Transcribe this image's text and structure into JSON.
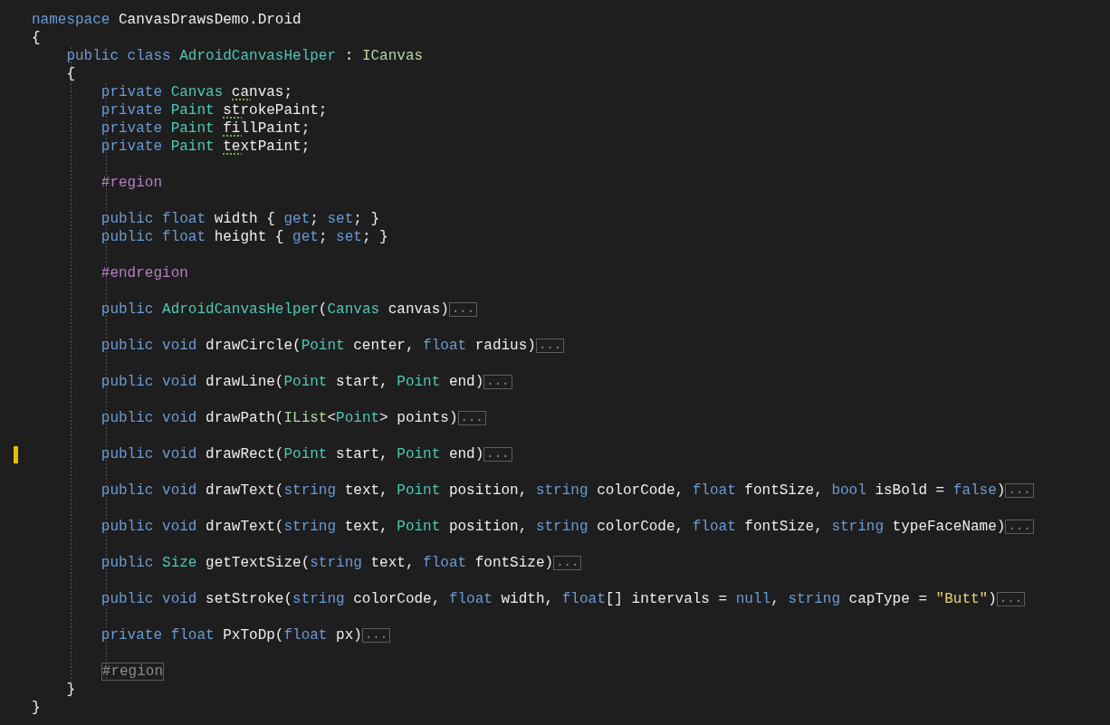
{
  "editor": {
    "lines": [
      {
        "kind": "code",
        "modified": false,
        "tokens": [
          {
            "text": "namespace ",
            "kind": "keyword"
          },
          {
            "text": "CanvasDrawsDemo.Droid",
            "kind": "plain"
          }
        ]
      },
      {
        "kind": "code",
        "modified": false,
        "tokens": [
          {
            "text": "{",
            "kind": "plain"
          }
        ],
        "children": [
          {
            "kind": "code",
            "modified": false,
            "tokens": [
              {
                "text": "public class ",
                "kind": "keyword"
              },
              {
                "text": "AdroidCanvasHelper",
                "kind": "type"
              },
              {
                "text": " : ",
                "kind": "plain"
              },
              {
                "text": "ICanvas",
                "kind": "interface"
              }
            ]
          },
          {
            "kind": "code",
            "modified": false,
            "tokens": [
              {
                "text": "{",
                "kind": "plain"
              }
            ],
            "children": [
              {
                "kind": "code",
                "modified": false,
                "tokens": [
                  {
                    "text": "private ",
                    "kind": "keyword"
                  },
                  {
                    "text": "Canvas ",
                    "kind": "type"
                  },
                  {
                    "text": "canvas",
                    "kind": "warning"
                  },
                  {
                    "text": ";",
                    "kind": "plain"
                  }
                ]
              },
              {
                "kind": "code",
                "modified": false,
                "tokens": [
                  {
                    "text": "private ",
                    "kind": "keyword"
                  },
                  {
                    "text": "Paint ",
                    "kind": "type"
                  },
                  {
                    "text": "strokePaint",
                    "kind": "warning"
                  },
                  {
                    "text": ";",
                    "kind": "plain"
                  }
                ]
              },
              {
                "kind": "code",
                "modified": false,
                "tokens": [
                  {
                    "text": "private ",
                    "kind": "keyword"
                  },
                  {
                    "text": "Paint ",
                    "kind": "type"
                  },
                  {
                    "text": "fillPaint",
                    "kind": "warning"
                  },
                  {
                    "text": ";",
                    "kind": "plain"
                  }
                ]
              },
              {
                "kind": "code",
                "modified": false,
                "tokens": [
                  {
                    "text": "private ",
                    "kind": "keyword"
                  },
                  {
                    "text": "Paint ",
                    "kind": "type"
                  },
                  {
                    "text": "textPaint",
                    "kind": "warning"
                  },
                  {
                    "text": ";",
                    "kind": "plain"
                  }
                ]
              },
              {
                "kind": "blank"
              },
              {
                "kind": "code",
                "modified": false,
                "tokens": [
                  {
                    "text": "#region",
                    "kind": "preprocessor"
                  }
                ]
              },
              {
                "kind": "blank"
              },
              {
                "kind": "code",
                "modified": false,
                "tokens": [
                  {
                    "text": "public float ",
                    "kind": "keyword"
                  },
                  {
                    "text": "width { ",
                    "kind": "plain"
                  },
                  {
                    "text": "get",
                    "kind": "keyword"
                  },
                  {
                    "text": "; ",
                    "kind": "plain"
                  },
                  {
                    "text": "set",
                    "kind": "keyword"
                  },
                  {
                    "text": "; }",
                    "kind": "plain"
                  }
                ]
              },
              {
                "kind": "code",
                "modified": false,
                "tokens": [
                  {
                    "text": "public float ",
                    "kind": "keyword"
                  },
                  {
                    "text": "height { ",
                    "kind": "plain"
                  },
                  {
                    "text": "get",
                    "kind": "keyword"
                  },
                  {
                    "text": "; ",
                    "kind": "plain"
                  },
                  {
                    "text": "set",
                    "kind": "keyword"
                  },
                  {
                    "text": "; }",
                    "kind": "plain"
                  }
                ]
              },
              {
                "kind": "blank"
              },
              {
                "kind": "code",
                "modified": false,
                "tokens": [
                  {
                    "text": "#endregion",
                    "kind": "preprocessor"
                  }
                ]
              },
              {
                "kind": "blank"
              },
              {
                "kind": "code",
                "modified": false,
                "tokens": [
                  {
                    "text": "public ",
                    "kind": "keyword"
                  },
                  {
                    "text": "AdroidCanvasHelper",
                    "kind": "type"
                  },
                  {
                    "text": "(",
                    "kind": "plain"
                  },
                  {
                    "text": "Canvas ",
                    "kind": "type"
                  },
                  {
                    "text": "canvas)",
                    "kind": "plain"
                  },
                  {
                    "text": "...",
                    "kind": "fold"
                  }
                ]
              },
              {
                "kind": "blank"
              },
              {
                "kind": "code",
                "modified": false,
                "tokens": [
                  {
                    "text": "public void ",
                    "kind": "keyword"
                  },
                  {
                    "text": "drawCircle(",
                    "kind": "plain"
                  },
                  {
                    "text": "Point ",
                    "kind": "type"
                  },
                  {
                    "text": "center, ",
                    "kind": "plain"
                  },
                  {
                    "text": "float ",
                    "kind": "keyword"
                  },
                  {
                    "text": "radius)",
                    "kind": "plain"
                  },
                  {
                    "text": "...",
                    "kind": "fold"
                  }
                ]
              },
              {
                "kind": "blank"
              },
              {
                "kind": "code",
                "modified": false,
                "tokens": [
                  {
                    "text": "public void ",
                    "kind": "keyword"
                  },
                  {
                    "text": "drawLine(",
                    "kind": "plain"
                  },
                  {
                    "text": "Point ",
                    "kind": "type"
                  },
                  {
                    "text": "start, ",
                    "kind": "plain"
                  },
                  {
                    "text": "Point ",
                    "kind": "type"
                  },
                  {
                    "text": "end)",
                    "kind": "plain"
                  },
                  {
                    "text": "...",
                    "kind": "fold"
                  }
                ]
              },
              {
                "kind": "blank"
              },
              {
                "kind": "code",
                "modified": false,
                "tokens": [
                  {
                    "text": "public void ",
                    "kind": "keyword"
                  },
                  {
                    "text": "drawPath(",
                    "kind": "plain"
                  },
                  {
                    "text": "IList",
                    "kind": "interface"
                  },
                  {
                    "text": "<",
                    "kind": "plain"
                  },
                  {
                    "text": "Point",
                    "kind": "type"
                  },
                  {
                    "text": "> points)",
                    "kind": "plain"
                  },
                  {
                    "text": "...",
                    "kind": "fold"
                  }
                ]
              },
              {
                "kind": "blank"
              },
              {
                "kind": "code",
                "modified": true,
                "tokens": [
                  {
                    "text": "public void ",
                    "kind": "keyword"
                  },
                  {
                    "text": "drawRect(",
                    "kind": "plain"
                  },
                  {
                    "text": "Point ",
                    "kind": "type"
                  },
                  {
                    "text": "start, ",
                    "kind": "plain"
                  },
                  {
                    "text": "Point ",
                    "kind": "type"
                  },
                  {
                    "text": "end)",
                    "kind": "plain"
                  },
                  {
                    "text": "...",
                    "kind": "fold"
                  }
                ]
              },
              {
                "kind": "blank"
              },
              {
                "kind": "code",
                "modified": false,
                "tokens": [
                  {
                    "text": "public void ",
                    "kind": "keyword"
                  },
                  {
                    "text": "drawText(",
                    "kind": "plain"
                  },
                  {
                    "text": "string ",
                    "kind": "keyword"
                  },
                  {
                    "text": "text, ",
                    "kind": "plain"
                  },
                  {
                    "text": "Point ",
                    "kind": "type"
                  },
                  {
                    "text": "position, ",
                    "kind": "plain"
                  },
                  {
                    "text": "string ",
                    "kind": "keyword"
                  },
                  {
                    "text": "colorCode, ",
                    "kind": "plain"
                  },
                  {
                    "text": "float ",
                    "kind": "keyword"
                  },
                  {
                    "text": "fontSize, ",
                    "kind": "plain"
                  },
                  {
                    "text": "bool ",
                    "kind": "keyword"
                  },
                  {
                    "text": "isBold = ",
                    "kind": "plain"
                  },
                  {
                    "text": "false",
                    "kind": "keyword"
                  },
                  {
                    "text": ")",
                    "kind": "plain"
                  },
                  {
                    "text": "...",
                    "kind": "fold"
                  }
                ]
              },
              {
                "kind": "blank"
              },
              {
                "kind": "code",
                "modified": false,
                "tokens": [
                  {
                    "text": "public void ",
                    "kind": "keyword"
                  },
                  {
                    "text": "drawText(",
                    "kind": "plain"
                  },
                  {
                    "text": "string ",
                    "kind": "keyword"
                  },
                  {
                    "text": "text, ",
                    "kind": "plain"
                  },
                  {
                    "text": "Point ",
                    "kind": "type"
                  },
                  {
                    "text": "position, ",
                    "kind": "plain"
                  },
                  {
                    "text": "string ",
                    "kind": "keyword"
                  },
                  {
                    "text": "colorCode, ",
                    "kind": "plain"
                  },
                  {
                    "text": "float ",
                    "kind": "keyword"
                  },
                  {
                    "text": "fontSize, ",
                    "kind": "plain"
                  },
                  {
                    "text": "string ",
                    "kind": "keyword"
                  },
                  {
                    "text": "typeFaceName)",
                    "kind": "plain"
                  },
                  {
                    "text": "...",
                    "kind": "fold"
                  }
                ]
              },
              {
                "kind": "blank"
              },
              {
                "kind": "code",
                "modified": false,
                "tokens": [
                  {
                    "text": "public ",
                    "kind": "keyword"
                  },
                  {
                    "text": "Size ",
                    "kind": "type"
                  },
                  {
                    "text": "getTextSize(",
                    "kind": "plain"
                  },
                  {
                    "text": "string ",
                    "kind": "keyword"
                  },
                  {
                    "text": "text, ",
                    "kind": "plain"
                  },
                  {
                    "text": "float ",
                    "kind": "keyword"
                  },
                  {
                    "text": "fontSize)",
                    "kind": "plain"
                  },
                  {
                    "text": "...",
                    "kind": "fold"
                  }
                ]
              },
              {
                "kind": "blank"
              },
              {
                "kind": "code",
                "modified": false,
                "tokens": [
                  {
                    "text": "public void ",
                    "kind": "keyword"
                  },
                  {
                    "text": "setStroke(",
                    "kind": "plain"
                  },
                  {
                    "text": "string ",
                    "kind": "keyword"
                  },
                  {
                    "text": "colorCode, ",
                    "kind": "plain"
                  },
                  {
                    "text": "float ",
                    "kind": "keyword"
                  },
                  {
                    "text": "width, ",
                    "kind": "plain"
                  },
                  {
                    "text": "float",
                    "kind": "keyword"
                  },
                  {
                    "text": "[] intervals = ",
                    "kind": "plain"
                  },
                  {
                    "text": "null",
                    "kind": "keyword"
                  },
                  {
                    "text": ", ",
                    "kind": "plain"
                  },
                  {
                    "text": "string ",
                    "kind": "keyword"
                  },
                  {
                    "text": "capType = ",
                    "kind": "plain"
                  },
                  {
                    "text": "\"Butt\"",
                    "kind": "string"
                  },
                  {
                    "text": ")",
                    "kind": "plain"
                  },
                  {
                    "text": "...",
                    "kind": "fold"
                  }
                ]
              },
              {
                "kind": "blank"
              },
              {
                "kind": "code",
                "modified": false,
                "tokens": [
                  {
                    "text": "private float ",
                    "kind": "keyword"
                  },
                  {
                    "text": "PxToDp(",
                    "kind": "plain"
                  },
                  {
                    "text": "float ",
                    "kind": "keyword"
                  },
                  {
                    "text": "px)",
                    "kind": "plain"
                  },
                  {
                    "text": "...",
                    "kind": "fold"
                  }
                ]
              },
              {
                "kind": "blank"
              },
              {
                "kind": "code",
                "modified": false,
                "tokens": [
                  {
                    "text": "#region",
                    "kind": "collapsed"
                  }
                ]
              }
            ]
          },
          {
            "kind": "code",
            "modified": false,
            "tokens": [
              {
                "text": "}",
                "kind": "plain"
              }
            ]
          }
        ]
      },
      {
        "kind": "code",
        "modified": false,
        "tokens": [
          {
            "text": "}",
            "kind": "plain"
          }
        ]
      }
    ]
  }
}
